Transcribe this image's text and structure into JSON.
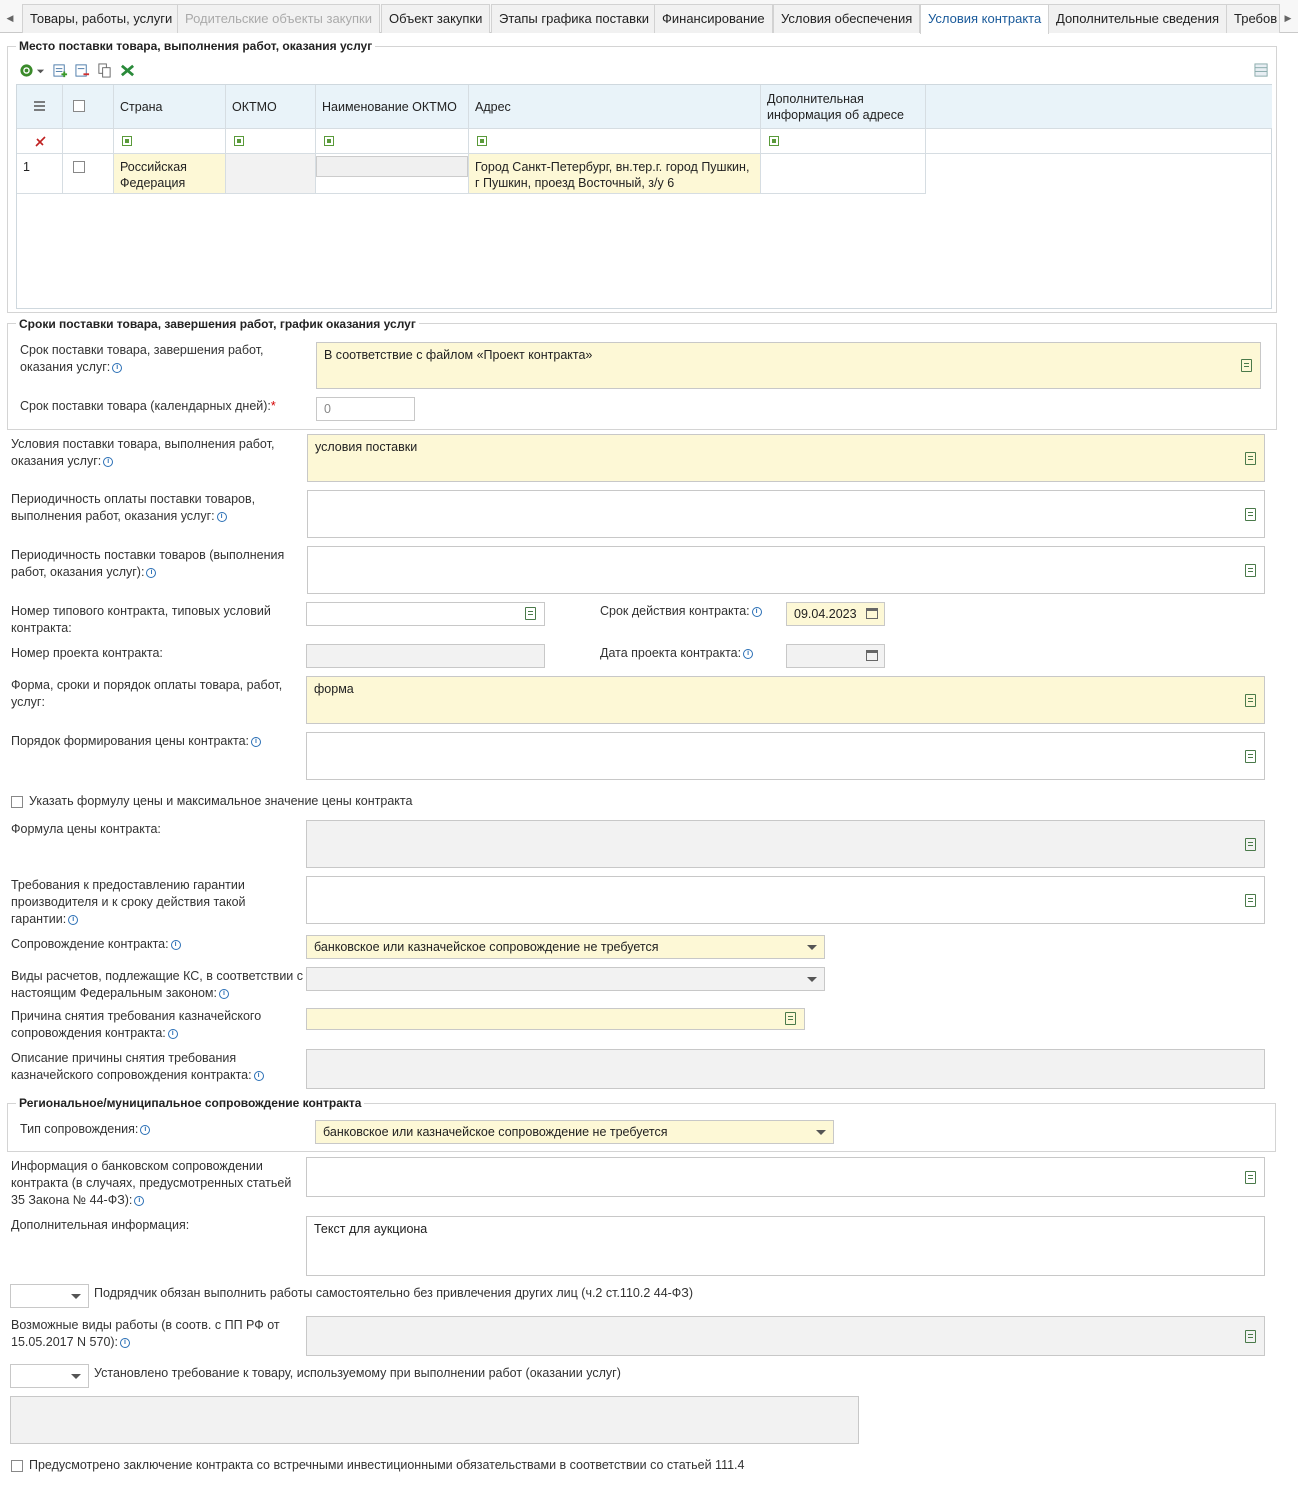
{
  "tabs": [
    {
      "label": "Товары, работы, услуги",
      "state": "normal"
    },
    {
      "label": "Родительские объекты закупки",
      "state": "disabled"
    },
    {
      "label": "Объект закупки",
      "state": "normal"
    },
    {
      "label": "Этапы графика поставки",
      "state": "normal"
    },
    {
      "label": "Финансирование",
      "state": "normal"
    },
    {
      "label": "Условия обеспечения",
      "state": "normal"
    },
    {
      "label": "Условия контракта",
      "state": "active"
    },
    {
      "label": "Дополнительные сведения",
      "state": "normal"
    },
    {
      "label": "Требов",
      "state": "normal"
    }
  ],
  "delivery_place": {
    "legend": "Место поставки товара, выполнения работ, оказания услуг",
    "columns": [
      "Страна",
      "ОКТМО",
      "Наименование ОКТМО",
      "Адрес",
      "Дополнительная информация об адресе"
    ],
    "rows": [
      {
        "num": "1",
        "country": "Российская Федерация",
        "oktmo": "",
        "oktmo_name": "",
        "address": "Город Санкт-Петербург, вн.тер.г. город Пушкин, г Пушкин, проезд Восточный, з/у 6",
        "extra": ""
      }
    ]
  },
  "terms": {
    "legend": "Сроки поставки товара, завершения работ, график оказания услуг",
    "term_label": "Срок поставки товара, завершения работ, оказания услуг:",
    "term_value": "В соответствие с файлом «Проект контракта»",
    "days_label": "Срок поставки товара (календарных дней):",
    "days_value": "0"
  },
  "form": {
    "conditions_label": "Условия поставки товара, выполнения работ, оказания услуг:",
    "conditions_value": "условия поставки",
    "pay_period_label": "Периодичность оплаты поставки товаров, выполнения работ, оказания услуг:",
    "pay_period_value": "",
    "supply_period_label": "Периодичность поставки товаров (выполнения работ, оказания услуг):",
    "supply_period_value": "",
    "typical_label": "Номер типового контракта, типовых условий контракта:",
    "validity_label": "Срок действия контракта:",
    "validity_value": "09.04.2023",
    "project_num_label": "Номер проекта контракта:",
    "project_date_label": "Дата проекта контракта:",
    "payment_form_label": "Форма, сроки и порядок оплаты товара, работ, услуг:",
    "payment_form_value": "форма",
    "price_order_label": "Порядок формирования цены контракта:",
    "formula_checkbox_label": "Указать формулу цены и максимальное значение цены контракта",
    "formula_label": "Формула цены контракта:",
    "guarantee_label": "Требования к предоставлению гарантии производителя и к сроку действия такой гарантии:",
    "support_label": "Сопровождение контракта:",
    "support_value": "банковское или казначейское сопровождение не требуется",
    "ks_label": "Виды расчетов, подлежащие КС, в соответствии с настоящим Федеральным законом:",
    "reason_label": "Причина снятия требования казначейского сопровождения контракта:",
    "reason_desc_label": "Описание причины снятия требования казначейского сопровождения контракта:"
  },
  "regional": {
    "legend": "Региональное/муниципальное сопровождение контракта",
    "type_label": "Тип сопровождения:",
    "type_value": "банковское или казначейское сопровождение не требуется"
  },
  "bottom": {
    "bank_info_label": "Информация о банковском сопровождении контракта (в случаях, предусмотренных статьей 35 Закона № 44-ФЗ):",
    "extra_label": "Дополнительная информация:",
    "extra_value": "Текст для аукциона",
    "contractor_label": "Подрядчик обязан выполнить работы самостоятельно без привлечения других лиц (ч.2 ст.110.2 44-ФЗ)",
    "work_types_label": "Возможные виды работы (в соотв. с ПП РФ от 15.05.2017 N 570):",
    "goods_req_label": "Установлено требование к товару, используемому при выполнении работ (оказании услуг)",
    "investment_label": "Предусмотрено заключение контракта со встречными инвестиционными обязательствами в соответствии со статьей 111.4"
  }
}
